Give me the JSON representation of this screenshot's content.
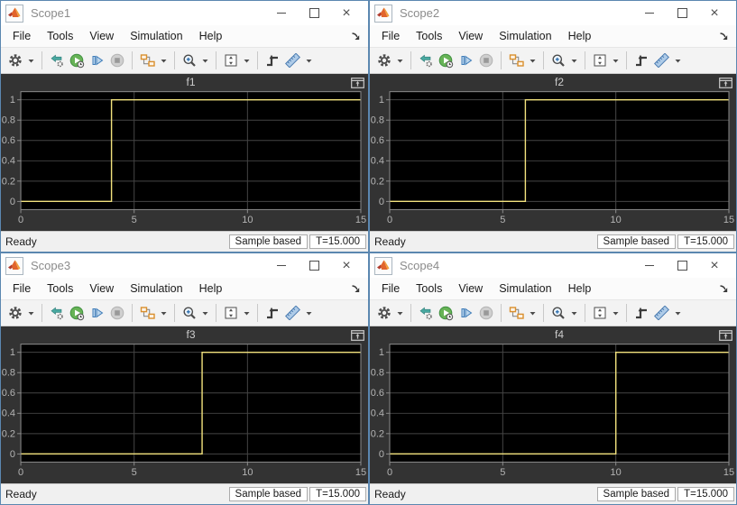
{
  "colors": {
    "window_border": "#5b87b0",
    "plot_bg": "#333333",
    "axes_bg": "#000000",
    "grid": "#454545",
    "axis_border": "#8c8c8c",
    "tick_label": "#b4b4b4",
    "plot_title": "#cdcdcd",
    "trace_yellow": "#f2e27d",
    "run_green": "#67b356",
    "step_blue": "#3f7cb8",
    "block_orange": "#d98f2e"
  },
  "chrome": {
    "close_glyph": "×",
    "window_controls": [
      "minimize",
      "maximize",
      "close"
    ]
  },
  "toolbar_icons": [
    "settings-gear",
    "highlight-simulink-block",
    "run",
    "step-forward",
    "stop",
    "signal-selector",
    "zoom-in",
    "scale-y-axes",
    "triggers",
    "cursor-measurements"
  ],
  "windows": [
    {
      "title": "Scope1",
      "menu": [
        "File",
        "Tools",
        "View",
        "Simulation",
        "Help"
      ],
      "plot": {
        "type": "line",
        "title": "f1",
        "step_time": 4,
        "points": [
          [
            0,
            0
          ],
          [
            4,
            0
          ],
          [
            4,
            1
          ],
          [
            15,
            1
          ]
        ],
        "xlim": [
          0,
          15
        ],
        "ylim": [
          -0.08,
          1.08
        ],
        "x_ticks": [
          0,
          5,
          10,
          15
        ],
        "y_ticks": [
          0,
          0.2,
          0.4,
          0.6,
          0.8,
          1
        ],
        "line_color": "#f2e27d"
      },
      "status": {
        "ready": "Ready",
        "mode": "Sample based",
        "time": "T=15.000"
      }
    },
    {
      "title": "Scope2",
      "menu": [
        "File",
        "Tools",
        "View",
        "Simulation",
        "Help"
      ],
      "plot": {
        "type": "line",
        "title": "f2",
        "step_time": 6,
        "points": [
          [
            0,
            0
          ],
          [
            6,
            0
          ],
          [
            6,
            1
          ],
          [
            15,
            1
          ]
        ],
        "xlim": [
          0,
          15
        ],
        "ylim": [
          -0.08,
          1.08
        ],
        "x_ticks": [
          0,
          5,
          10,
          15
        ],
        "y_ticks": [
          0,
          0.2,
          0.4,
          0.6,
          0.8,
          1
        ],
        "line_color": "#f2e27d"
      },
      "status": {
        "ready": "Ready",
        "mode": "Sample based",
        "time": "T=15.000"
      }
    },
    {
      "title": "Scope3",
      "menu": [
        "File",
        "Tools",
        "View",
        "Simulation",
        "Help"
      ],
      "plot": {
        "type": "line",
        "title": "f3",
        "step_time": 8,
        "points": [
          [
            0,
            0
          ],
          [
            8,
            0
          ],
          [
            8,
            1
          ],
          [
            15,
            1
          ]
        ],
        "xlim": [
          0,
          15
        ],
        "ylim": [
          -0.08,
          1.08
        ],
        "x_ticks": [
          0,
          5,
          10,
          15
        ],
        "y_ticks": [
          0,
          0.2,
          0.4,
          0.6,
          0.8,
          1
        ],
        "line_color": "#f2e27d"
      },
      "status": {
        "ready": "Ready",
        "mode": "Sample based",
        "time": "T=15.000"
      }
    },
    {
      "title": "Scope4",
      "menu": [
        "File",
        "Tools",
        "View",
        "Simulation",
        "Help"
      ],
      "plot": {
        "type": "line",
        "title": "f4",
        "step_time": 10,
        "points": [
          [
            0,
            0
          ],
          [
            10,
            0
          ],
          [
            10,
            1
          ],
          [
            15,
            1
          ]
        ],
        "xlim": [
          0,
          15
        ],
        "ylim": [
          -0.08,
          1.08
        ],
        "x_ticks": [
          0,
          5,
          10,
          15
        ],
        "y_ticks": [
          0,
          0.2,
          0.4,
          0.6,
          0.8,
          1
        ],
        "line_color": "#f2e27d"
      },
      "status": {
        "ready": "Ready",
        "mode": "Sample based",
        "time": "T=15.000"
      }
    }
  ],
  "chart_data": [
    {
      "type": "line",
      "title": "f1",
      "x": [
        0,
        4,
        4,
        15
      ],
      "y": [
        0,
        0,
        1,
        1
      ],
      "step_time": 4,
      "xlim": [
        0,
        15
      ],
      "x_ticks": [
        0,
        5,
        10,
        15
      ],
      "y_ticks": [
        0,
        0.2,
        0.4,
        0.6,
        0.8,
        1
      ],
      "grid": true,
      "legend": false
    },
    {
      "type": "line",
      "title": "f2",
      "x": [
        0,
        6,
        6,
        15
      ],
      "y": [
        0,
        0,
        1,
        1
      ],
      "step_time": 6,
      "xlim": [
        0,
        15
      ],
      "x_ticks": [
        0,
        5,
        10,
        15
      ],
      "y_ticks": [
        0,
        0.2,
        0.4,
        0.6,
        0.8,
        1
      ],
      "grid": true,
      "legend": false
    },
    {
      "type": "line",
      "title": "f3",
      "x": [
        0,
        8,
        8,
        15
      ],
      "y": [
        0,
        0,
        1,
        1
      ],
      "step_time": 8,
      "xlim": [
        0,
        15
      ],
      "x_ticks": [
        0,
        5,
        10,
        15
      ],
      "y_ticks": [
        0,
        0.2,
        0.4,
        0.6,
        0.8,
        1
      ],
      "grid": true,
      "legend": false
    },
    {
      "type": "line",
      "title": "f4",
      "x": [
        0,
        10,
        10,
        15
      ],
      "y": [
        0,
        0,
        1,
        1
      ],
      "step_time": 10,
      "xlim": [
        0,
        15
      ],
      "x_ticks": [
        0,
        5,
        10,
        15
      ],
      "y_ticks": [
        0,
        0.2,
        0.4,
        0.6,
        0.8,
        1
      ],
      "grid": true,
      "legend": false
    }
  ]
}
